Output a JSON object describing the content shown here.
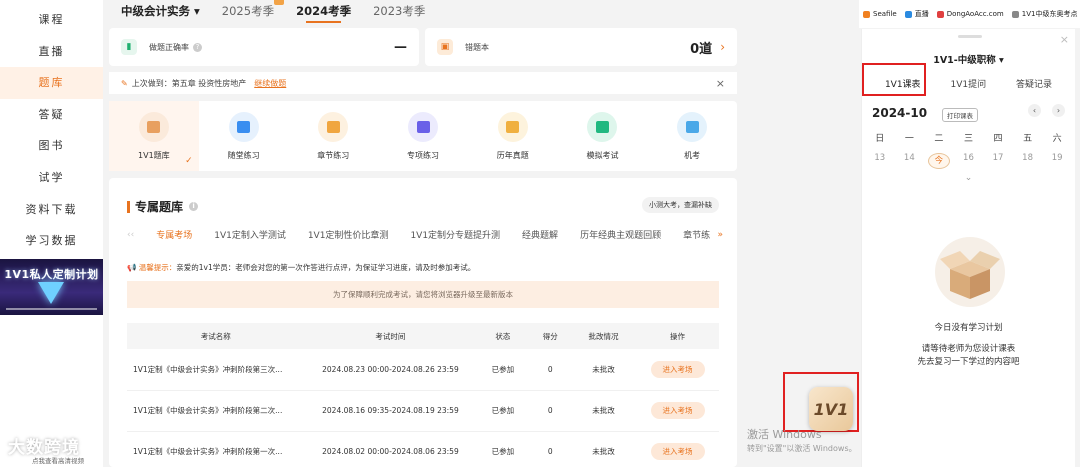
{
  "sidebar": {
    "items": [
      {
        "label": "课程"
      },
      {
        "label": "直播"
      },
      {
        "label": "题库",
        "active": true
      },
      {
        "label": "答疑"
      },
      {
        "label": "图书"
      },
      {
        "label": "试学"
      },
      {
        "label": "资料下载"
      },
      {
        "label": "学习数据"
      }
    ],
    "banner_text": "1V1私人定制计划"
  },
  "topbar": {
    "subject": "中级会计实务",
    "subject_arrow": "▾",
    "seasons": [
      "2025考季",
      "2024考季",
      "2023考季"
    ],
    "active_season": "2024考季"
  },
  "stats": {
    "accuracy_label": "做题正确率",
    "accuracy_value": "—",
    "wrongbook_label": "错题本",
    "wrongbook_value": "0道",
    "chevron": "›"
  },
  "lastdone": {
    "text": "上次做到：第五章 投资性房地产",
    "link": "继续做题",
    "close": "×"
  },
  "categories": [
    {
      "label": "1V1题库",
      "color": "#e8a060",
      "bg": "#fbeadb"
    },
    {
      "label": "随堂练习",
      "color": "#3a8ef0",
      "bg": "#e6f1fd"
    },
    {
      "label": "章节练习",
      "color": "#f0a640",
      "bg": "#fdf1e0"
    },
    {
      "label": "专项练习",
      "color": "#6a60e8",
      "bg": "#ecebfd"
    },
    {
      "label": "历年真题",
      "color": "#f0b040",
      "bg": "#fdf3dd"
    },
    {
      "label": "模拟考试",
      "color": "#20b880",
      "bg": "#def6ec"
    },
    {
      "label": "机考",
      "color": "#4aa8e8",
      "bg": "#e4f2fc"
    }
  ],
  "exam": {
    "title": "专属题库",
    "tag": "小测大考，查漏补缺",
    "tabs": [
      "专属考场",
      "1V1定制入学测试",
      "1V1定制性价比章测",
      "1V1定制分专题提升测",
      "经典题解",
      "历年经典主观题回顾",
      "章节练"
    ],
    "active_tab": "专属考场",
    "more": "»",
    "tip_prefix": "温馨提示：",
    "tip_text": "亲爱的1v1学员：老师会对您的第一次作答进行点评，为保证学习进度，请及时参加考试。",
    "notice": "为了保障顺利完成考试，请您将浏览器升级至最新版本",
    "columns": [
      "考试名称",
      "考试时间",
      "状态",
      "得分",
      "批改情况",
      "操作"
    ],
    "rows": [
      {
        "name": "1V1定制《中级会计实务》冲刺阶段第三次...",
        "time": "2024.08.23 00:00-2024.08.26 23:59",
        "status": "已参加",
        "score": "0",
        "review": "未批改",
        "action": "进入考场"
      },
      {
        "name": "1V1定制《中级会计实务》冲刺阶段第二次...",
        "time": "2024.08.16 09:35-2024.08.19 23:59",
        "status": "已参加",
        "score": "0",
        "review": "未批改",
        "action": "进入考场"
      },
      {
        "name": "1V1定制《中级会计实务》冲刺阶段第一次...",
        "time": "2024.08.02 00:00-2024.08.06 23:59",
        "status": "已参加",
        "score": "0",
        "review": "未批改",
        "action": "进入考场"
      }
    ]
  },
  "bookmarks": [
    {
      "label": "Seafile",
      "color": "#f08020"
    },
    {
      "label": "直播",
      "color": "#2a8ae0"
    },
    {
      "label": "DongAoAcc.com",
      "color": "#e04040"
    },
    {
      "label": "1V1中级东奥考点",
      "color": "#888888"
    }
  ],
  "panel": {
    "title": "1V1-中级职称 ▾",
    "tabs": [
      "1V1课表",
      "1V1提问",
      "答疑记录"
    ],
    "active_tab": "1V1课表",
    "month": "2024-10",
    "print": "打印课表",
    "prev": "‹",
    "next": "›",
    "weekdays": [
      "日",
      "一",
      "二",
      "三",
      "四",
      "五",
      "六"
    ],
    "days": [
      "13",
      "14",
      "今",
      "16",
      "17",
      "18",
      "19"
    ],
    "expand": "⌄",
    "empty_title": "今日没有学习计划",
    "empty_line1": "请等待老师为您设计课表",
    "empty_line2": "先去复习一下学过的内容吧"
  },
  "floating": {
    "label": "1V1"
  },
  "windows": {
    "line1": "激活 Windows",
    "line2": "转到\"设置\"以激活 Windows。"
  },
  "watermark": {
    "text": "大数跨境",
    "small": "点我查看高清视频"
  }
}
